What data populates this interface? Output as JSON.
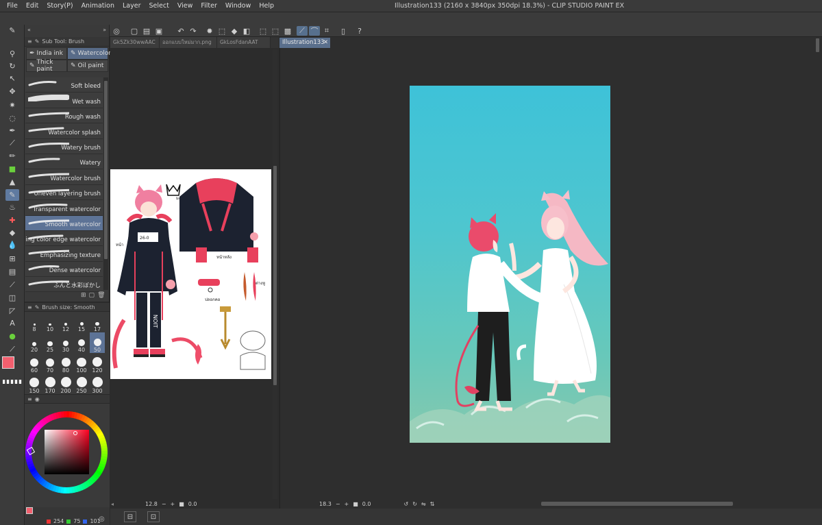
{
  "menu": [
    "File",
    "Edit",
    "Story(P)",
    "Animation",
    "Layer",
    "Select",
    "View",
    "Filter",
    "Window",
    "Help"
  ],
  "window_title": "Illustration133 (2160 x 3840px 350dpi 18.3%)  - CLIP STUDIO PAINT EX",
  "subtool": {
    "header": "Sub Tool: Brush",
    "tabs": [
      "India ink",
      "Watercolor",
      "Thick paint",
      "Oil paint"
    ],
    "brushes": [
      "Soft bleed",
      "Wet wash",
      "Rough wash",
      "Watercolor splash",
      "Watery brush",
      "Watery",
      "Watercolor brush",
      "Uneven layering brush",
      "Transparent watercolor",
      "Smooth watercolor",
      "Running color edge watercolor",
      "Emphasizing texture",
      "Dense watercolor",
      "ふんと水彩ぼかし"
    ]
  },
  "brush_size": {
    "header": "Brush size: Smooth",
    "sizes": [
      "8",
      "10",
      "12",
      "15",
      "17",
      "20",
      "25",
      "30",
      "40",
      "50",
      "60",
      "70",
      "80",
      "100",
      "120",
      "150",
      "170",
      "200",
      "250",
      "300"
    ]
  },
  "colors": {
    "main": "#f25f6e",
    "sub": "#fbd0d5",
    "rgb": [
      "254",
      "75",
      "101"
    ]
  },
  "doc_tabs": [
    "Gk5Zk30wwAAC",
    "ออกแบบใหม่มาก.png",
    "GkLosFdanAAT"
  ],
  "main_tab": "Illustration133",
  "left_view": {
    "zoom": "12.8",
    "angle": "0.0"
  },
  "main_view": {
    "zoom": "18.3",
    "angle": "0.0"
  },
  "ref_labels": {
    "crown": "มงกุฎ",
    "collar": "ปลอกคอ",
    "sleeve": "หน้า",
    "chest": "26-0",
    "pants": "NOIT",
    "tag": "ต่างหู",
    "jacket": "หน้าหลัง"
  }
}
